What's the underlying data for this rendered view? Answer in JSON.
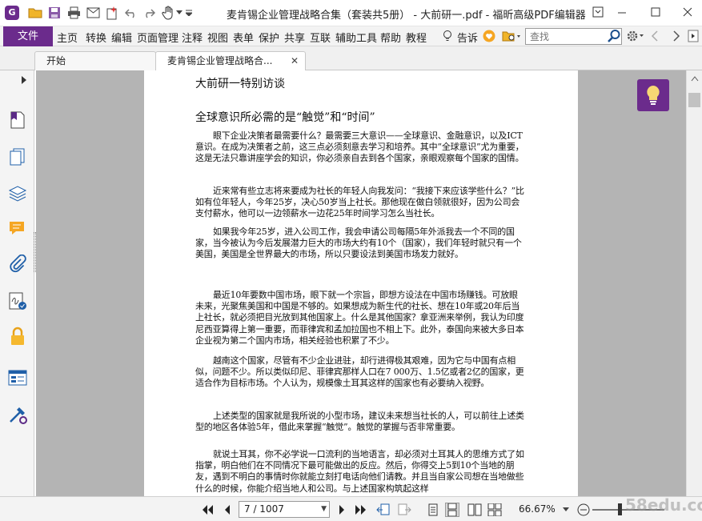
{
  "window": {
    "title": "麦肯锡企业管理战略合集（套装共5册） - 大前研一.pdf - 福昕高级PDF编辑器",
    "app_logo_letter": "G"
  },
  "menu": {
    "file": "文件",
    "items": [
      "主页",
      "转换",
      "编辑",
      "页面管理",
      "注释",
      "视图",
      "表单",
      "保护",
      "共享",
      "互联",
      "辅助工具",
      "帮助",
      "教程"
    ],
    "tell_me": "告诉",
    "search_placeholder": "查找"
  },
  "tabs": [
    {
      "label": "开始"
    },
    {
      "label": "麦肯锡企业管理战略合..."
    }
  ],
  "document": {
    "heading": "大前研一特别访谈",
    "subheading": "全球意识所必需的是“触觉”和“时间”",
    "paragraphs": [
      "眼下企业决策者最需要什么？最需要三大意识——全球意识、金融意识，以及ICT意识。在成为决策者之前，这三点必须刻意去学习和培养。其中“全球意识”尤为重要，这是无法只靠讲座学会的知识，你必须亲自去到各个国家，亲眼观察每个国家的国情。",
      "近来常有些立志将来要成为社长的年轻人向我发问：“我接下来应该学些什么？”比如有位年轻人，今年25岁，决心50岁当上社长。那他现在做白领就很好，因为公司会支付薪水，他可以一边领薪水一边花25年时间学习怎么当社长。",
      "如果我今年25岁，进入公司工作，我会申请公司每隔5年外派我去一个不同的国家，当今被认为今后发展潜力巨大的市场大约有10个（国家），我们年轻时就只有一个美国，美国是全世界最大的市场，所以只要设法到美国市场发力就好。",
      "最近10年要数中国市场，眼下就一个宗旨，即想方设法在中国市场赚钱。可放眼未来，光聚焦美国和中国是不够的。如果想成为新生代的社长、想在10年或20年后当上社长，就必须把目光放到其他国家上。什么是其他国家？拿亚洲来举例，我认为印度尼西亚算得上第一重要，而菲律宾和孟加拉国也不相上下。此外，泰国向来被大多日本企业视为第二个国内市场，相关经验也积累了不少。",
      "越南这个国家，尽管有不少企业进驻，却行进得极其艰难，因为它与中国有点相似，问题不少。所以类似印尼、菲律宾那样人口在7 000万、1.5亿或者2亿的国家，更适合作为目标市场。个人认为，规模像土耳其这样的国家也有必要纳入视野。",
      "上述类型的国家就是我所说的小型市场，建议未来想当社长的人，可以前往上述类型的地区各体验5年，借此来掌握“触觉”。触觉的掌握与否非常重要。",
      "就说土耳其，你不必学说一口流利的当地语言，却必须对土耳其人的思维方式了如指掌，明白他们在不同情况下最可能做出的反应。然后，你得交上5到10个当地的朋友，遇到不明白的事情时你就能立刻打电话向他们请教。并且当自家公司想在当地做些什么的时候，你能介绍当地人和公司。与上述国家构筑起这样"
    ]
  },
  "status": {
    "page_display": "7 / 1007",
    "zoom": "66.67%"
  },
  "watermark": "58edu.cc",
  "colors": {
    "brand": "#6b2b8c",
    "canvas": "#b4b4b4"
  }
}
